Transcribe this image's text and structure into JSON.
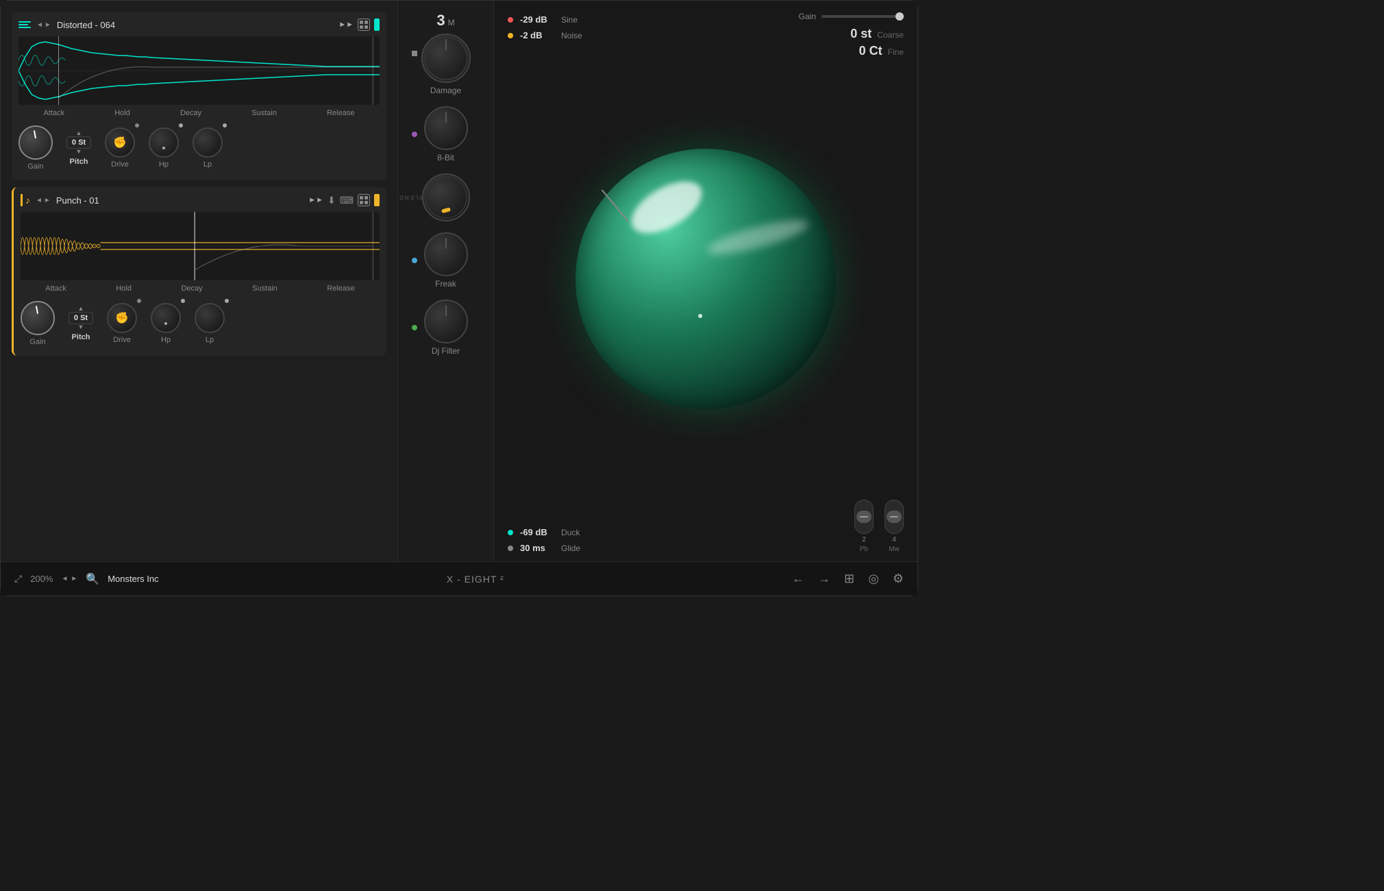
{
  "app": {
    "title": "X - EIGHT ²",
    "zoom": "200%",
    "preset": "Monsters Inc"
  },
  "sampler1": {
    "name": "Distorted - 064",
    "adsr": {
      "attack": "Attack",
      "hold": "Hold",
      "decay": "Decay",
      "sustain": "Sustain",
      "release": "Release"
    },
    "gain_label": "Gain",
    "pitch_label": "Pitch",
    "pitch_value": "0 St",
    "drive_label": "Drive",
    "hp_label": "Hp",
    "lp_label": "Lp"
  },
  "sampler2": {
    "name": "Punch - 01",
    "adsr": {
      "attack": "Attack",
      "hold": "Hold",
      "decay": "Decay",
      "sustain": "Sustain",
      "release": "Release"
    },
    "gain_label": "Gain",
    "pitch_label": "Pitch",
    "pitch_value": "0 St",
    "drive_label": "Drive",
    "hp_label": "Hp",
    "lp_label": "Lp"
  },
  "effects": {
    "damage": {
      "label": "Damage",
      "value": "3",
      "unit": "M"
    },
    "bit8": {
      "label": "8-Bit"
    },
    "blend": {
      "label": "BLEND"
    },
    "freak": {
      "label": "Freak"
    },
    "dj_filter": {
      "label": "Dj Filter"
    }
  },
  "oscillators": {
    "items": [
      {
        "label": "-29 dB",
        "sublabel": "Sine",
        "color": "#e55"
      },
      {
        "label": "-2 dB",
        "sublabel": "Noise",
        "color": "#f0b429"
      }
    ],
    "bottom_items": [
      {
        "label": "-69 dB",
        "sublabel": "Duck",
        "color": "#00e5cc"
      },
      {
        "label": "30 ms",
        "sublabel": "Glide",
        "color": "#888"
      }
    ]
  },
  "master": {
    "gain_label": "Gain",
    "coarse": {
      "value": "0 st",
      "label": "Coarse"
    },
    "fine": {
      "value": "0 Ct",
      "label": "Fine"
    },
    "pb": {
      "value": "2",
      "label": "Pb"
    },
    "mw": {
      "value": "4",
      "label": "Mw"
    }
  },
  "footer": {
    "expand_label": "⤢",
    "zoom_label": "200%",
    "search_label": "🔍",
    "preset_label": "Monsters Inc",
    "app_title": "X - EIGHT ²",
    "back": "←",
    "forward": "→",
    "grid_icon": "⊞",
    "record_icon": "◎",
    "settings_icon": "⚙"
  }
}
